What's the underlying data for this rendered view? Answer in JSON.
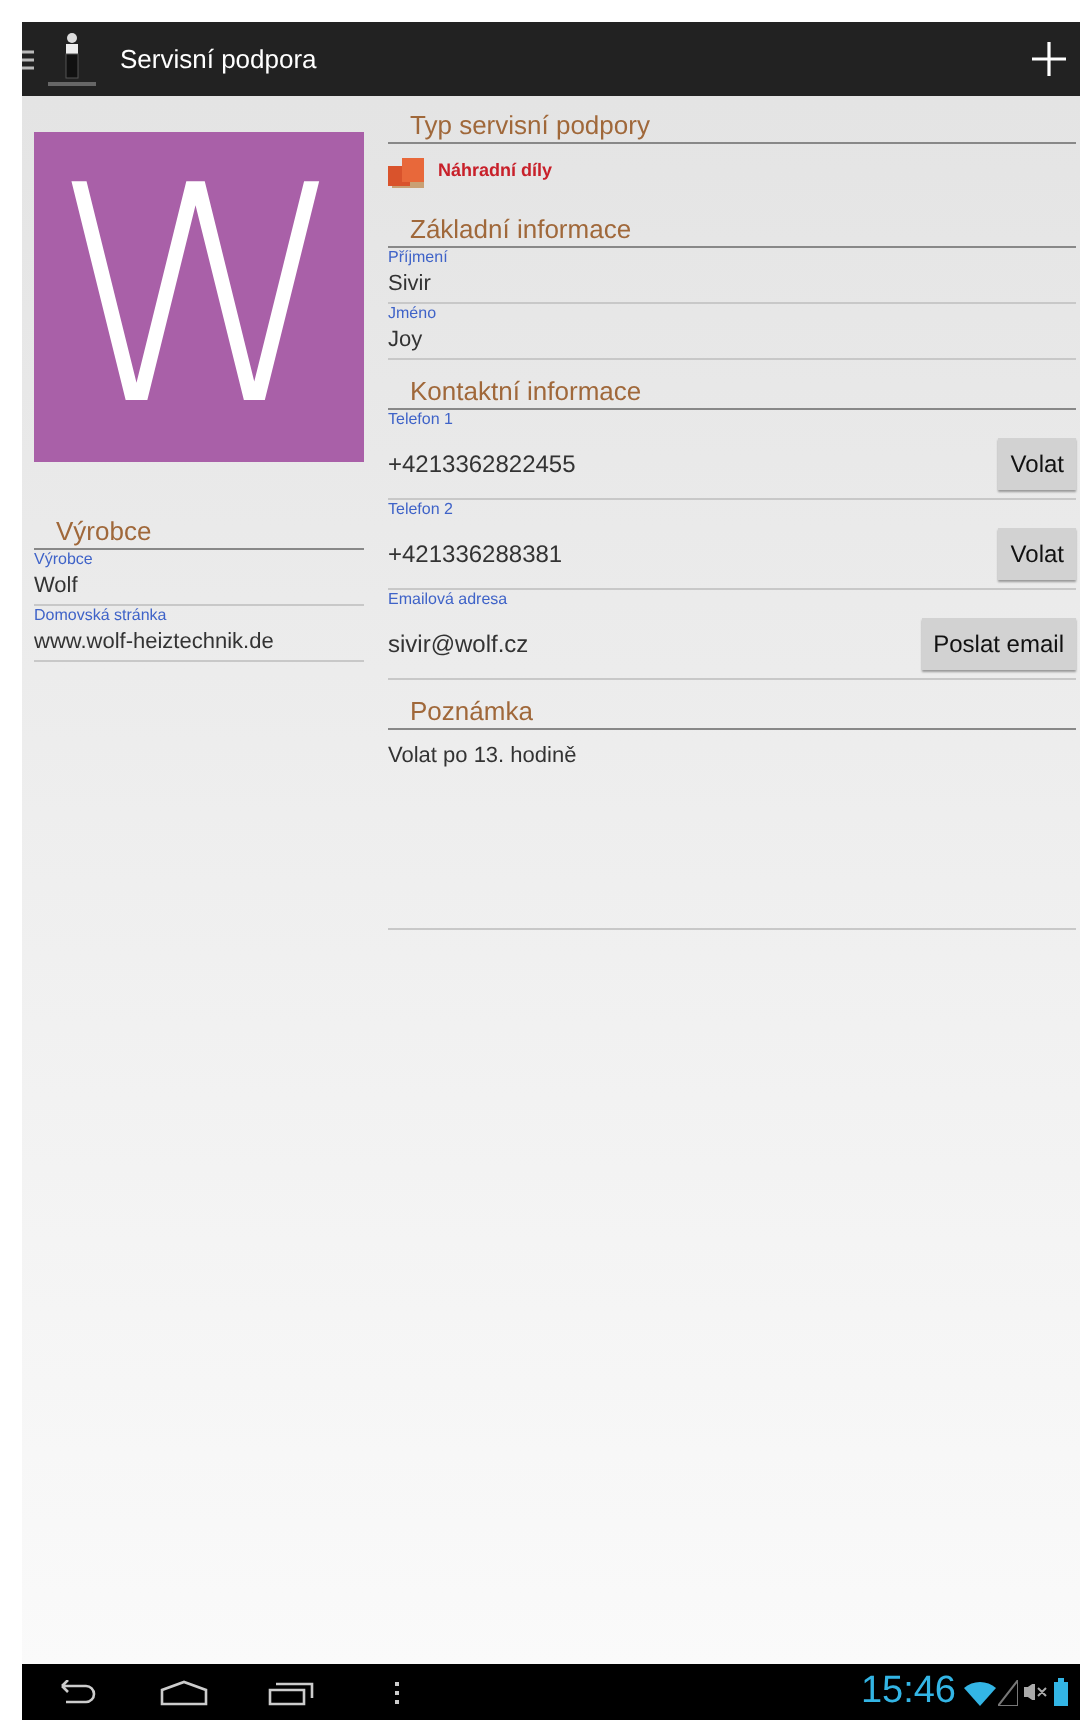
{
  "action_bar": {
    "title": "Servisní podpora"
  },
  "avatar": {
    "letter": "W"
  },
  "manufacturer": {
    "header": "Výrobce",
    "fields": [
      {
        "label": "Výrobce",
        "value": "Wolf"
      },
      {
        "label": "Domovská stránka",
        "value": "www.wolf-heiztechnik.de"
      }
    ]
  },
  "support_type": {
    "header": "Typ servisní podpory",
    "value": "Náhradní díly"
  },
  "basic_info": {
    "header": "Základní informace",
    "fields": [
      {
        "label": "Příjmení",
        "value": "Sivir"
      },
      {
        "label": "Jméno",
        "value": "Joy"
      }
    ]
  },
  "contact_info": {
    "header": "Kontaktní informace",
    "fields": [
      {
        "label": "Telefon 1",
        "value": "+4213362822455",
        "button": "Volat"
      },
      {
        "label": "Telefon 2",
        "value": "+421336288381",
        "button": "Volat"
      },
      {
        "label": "Emailová adresa",
        "value": "sivir@wolf.cz",
        "button": "Poslat email"
      }
    ]
  },
  "note": {
    "header": "Poznámka",
    "text": "Volat po 13. hodině"
  },
  "status_bar": {
    "time": "15:46"
  }
}
